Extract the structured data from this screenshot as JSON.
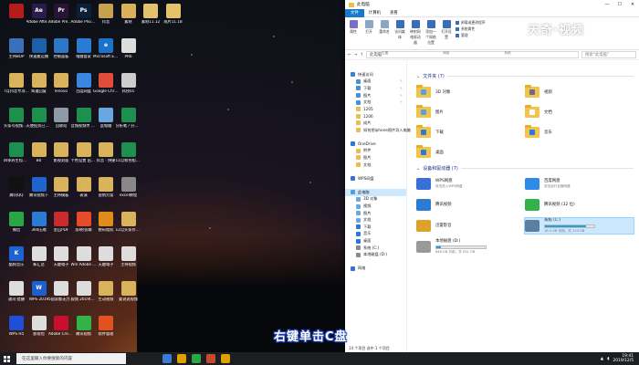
{
  "desktop_icons": [
    {
      "label": "",
      "color": "#b71c1c",
      "glyph": "",
      "col": 0,
      "row": 0
    },
    {
      "label": "Adobe After Effects CC 2018",
      "color": "#2a1b4d",
      "glyph": "Ae",
      "col": 1,
      "row": 0
    },
    {
      "label": "Adobe Premiere P...",
      "color": "#2a1436",
      "glyph": "Pr",
      "col": 2,
      "row": 0
    },
    {
      "label": "Adobe Photosh...",
      "color": "#0a1f3a",
      "glyph": "Ps",
      "col": 3,
      "row": 0
    },
    {
      "label": "抖音",
      "color": "#c8a150",
      "glyph": "",
      "col": 4,
      "row": 0
    },
    {
      "label": "素材",
      "color": "#d7b25a",
      "glyph": "",
      "col": 5,
      "row": 0
    },
    {
      "label": "素材11.12",
      "color": "#e4c26b",
      "glyph": "",
      "col": 6,
      "row": 0
    },
    {
      "label": "成片11.18",
      "color": "#e4c26b",
      "glyph": "",
      "col": 7,
      "row": 0
    },
    {
      "label": "主持BOP",
      "color": "#3c6fb7",
      "glyph": "",
      "col": 0,
      "row": 1
    },
    {
      "label": "快速搬运棚",
      "color": "#1d5fa8",
      "glyph": "",
      "col": 1,
      "row": 1
    },
    {
      "label": "控制面板",
      "color": "#2c78c6",
      "glyph": "",
      "col": 2,
      "row": 1
    },
    {
      "label": "电脑管家",
      "color": "#2b7bd3",
      "glyph": "",
      "col": 3,
      "row": 1
    },
    {
      "label": "Microsoft Edge",
      "color": "#1a73c9",
      "glyph": "e",
      "col": 4,
      "row": 1
    },
    {
      "label": "PR6",
      "color": "#ddd",
      "glyph": "",
      "col": 5,
      "row": 1
    },
    {
      "label": "7月抖音专项资料",
      "color": "#d9b35c",
      "glyph": "",
      "col": 0,
      "row": 2
    },
    {
      "label": "知道回复",
      "color": "#d9b35c",
      "glyph": "",
      "col": 1,
      "row": 2
    },
    {
      "label": "lenovo",
      "color": "#d9b35c",
      "glyph": "",
      "col": 2,
      "row": 2
    },
    {
      "label": "百度网盘",
      "color": "#3a86e0",
      "glyph": "",
      "col": 3,
      "row": 2
    },
    {
      "label": "Google Chrome",
      "color": "#e24c3b",
      "glyph": "",
      "col": 4,
      "row": 2
    },
    {
      "label": "科技01",
      "color": "#ccc",
      "glyph": "",
      "col": 5,
      "row": 2
    },
    {
      "label": "头条号视频分享给我做",
      "color": "#1d8f4e",
      "glyph": "",
      "col": 0,
      "row": 3
    },
    {
      "label": "天使投资已放电脑了",
      "color": "#1d8f4e",
      "glyph": "",
      "col": 1,
      "row": 3
    },
    {
      "label": "回收站",
      "color": "#8f9aa8",
      "glyph": "",
      "col": 2,
      "row": 3
    },
    {
      "label": "音频视频传 07.09(模)",
      "color": "#1d8f4e",
      "glyph": "",
      "col": 3,
      "row": 3
    },
    {
      "label": "此电脑",
      "color": "#6aa7e0",
      "glyph": "",
      "col": 4,
      "row": 3
    },
    {
      "label": "分析笔 / 分析 投资做电脑",
      "color": "#1d8f4e",
      "glyph": "",
      "col": 5,
      "row": 3
    },
    {
      "label": "四季养生短视频剪辑07.08",
      "color": "#1d8f4e",
      "glyph": "",
      "col": 0,
      "row": 4
    },
    {
      "label": "B0",
      "color": "#d9b35c",
      "glyph": "",
      "col": 1,
      "row": 4
    },
    {
      "label": "影视封面",
      "color": "#d9b35c",
      "glyph": "",
      "col": 2,
      "row": 4
    },
    {
      "label": "个性设置 出生语 word模板",
      "color": "#d9b35c",
      "glyph": "",
      "col": 3,
      "row": 4
    },
    {
      "label": "抖音 · 快捷",
      "color": "#d9b35c",
      "glyph": "",
      "col": 4,
      "row": 4
    },
    {
      "label": "11月和合相关的模板",
      "color": "#1d8f4e",
      "glyph": "",
      "col": 5,
      "row": 4
    },
    {
      "label": "腾讯QQ",
      "color": "#111",
      "glyph": "",
      "col": 0,
      "row": 5
    },
    {
      "label": "腾讯视频下",
      "color": "#1f63cf",
      "glyph": "",
      "col": 1,
      "row": 5
    },
    {
      "label": "主持模板",
      "color": "#d9b35c",
      "glyph": "",
      "col": 2,
      "row": 5
    },
    {
      "label": "表演",
      "color": "#d9b35c",
      "glyph": "",
      "col": 3,
      "row": 5
    },
    {
      "label": "营销方案",
      "color": "#d9b35c",
      "glyph": "",
      "col": 4,
      "row": 5
    },
    {
      "label": "excel教程",
      "color": "#888",
      "glyph": "",
      "col": 5,
      "row": 5
    },
    {
      "label": "微信",
      "color": "#2aa745",
      "glyph": "",
      "col": 0,
      "row": 6
    },
    {
      "label": "360压缩",
      "color": "#2a7bd6",
      "glyph": "",
      "col": 1,
      "row": 6
    },
    {
      "label": "金山PDF",
      "color": "#c82c2c",
      "glyph": "",
      "col": 2,
      "row": 6
    },
    {
      "label": "剪映/剪辑",
      "color": "#e64c2b",
      "glyph": "",
      "col": 3,
      "row": 6
    },
    {
      "label": "数码相机",
      "color": "#e08c1a",
      "glyph": "",
      "col": 4,
      "row": 6
    },
    {
      "label": "12月头条作业更新",
      "color": "#d9b35c",
      "glyph": "",
      "col": 5,
      "row": 6
    },
    {
      "label": "酷狗音乐",
      "color": "#1e63cf",
      "glyph": "K",
      "col": 0,
      "row": 7
    },
    {
      "label": "新汇总",
      "color": "#ddd",
      "glyph": "",
      "col": 1,
      "row": 7
    },
    {
      "label": "天融电子",
      "color": "#ddd",
      "glyph": "",
      "col": 2,
      "row": 7
    },
    {
      "label": "Win Adobe Win 2018 注册...",
      "color": "#ddd",
      "glyph": "",
      "col": 3,
      "row": 7
    },
    {
      "label": "天融电子",
      "color": "#ddd",
      "glyph": "",
      "col": 4,
      "row": 7
    },
    {
      "label": "主持视频",
      "color": "#ddd",
      "glyph": "",
      "col": 5,
      "row": 7
    },
    {
      "label": "通讯·提醒",
      "color": "#ddd",
      "glyph": "",
      "col": 0,
      "row": 8
    },
    {
      "label": "WPS 2019",
      "color": "#1e5fcf",
      "glyph": "W",
      "col": 1,
      "row": 8
    },
    {
      "label": "5国家都无力的 四字序字",
      "color": "#ddd",
      "glyph": "",
      "col": 2,
      "row": 8
    },
    {
      "label": "视频 2019(8)...",
      "color": "#ddd",
      "glyph": "",
      "col": 3,
      "row": 8
    },
    {
      "label": "生动视频",
      "color": "#d9b35c",
      "glyph": "",
      "col": 4,
      "row": 8
    },
    {
      "label": "要说说视频",
      "color": "#d9b35c",
      "glyph": "",
      "col": 5,
      "row": 8
    },
    {
      "label": "WPS H5",
      "color": "#1e4fd6",
      "glyph": "",
      "col": 0,
      "row": 9
    },
    {
      "label": "影视包",
      "color": "#ddd",
      "glyph": "",
      "col": 1,
      "row": 9
    },
    {
      "label": "Adobe Creati...",
      "color": "#c8102e",
      "glyph": "",
      "col": 2,
      "row": 9
    },
    {
      "label": "腾讯视频",
      "color": "#33b24a",
      "glyph": "",
      "col": 3,
      "row": 9
    },
    {
      "label": "软件管理",
      "color": "#e0521f",
      "glyph": "",
      "col": 4,
      "row": 9
    }
  ],
  "taskbar": {
    "search_placeholder": "在这里输入你要搜索的内容",
    "apps": [
      "#3a7bd5",
      "#e0a100",
      "#2aa745",
      "#c94a2b",
      "#e0a100"
    ],
    "time": "19:41",
    "date": "2019/12/5"
  },
  "explorer": {
    "title": "此电脑",
    "window_controls": [
      "—",
      "☐",
      "✕"
    ],
    "ribbon_tabs": [
      "文件",
      "计算机",
      "查看"
    ],
    "ribbon_buttons": [
      {
        "label": "属性",
        "color": "#7c6fc7"
      },
      {
        "label": "打开",
        "color": "#8aa7c7"
      },
      {
        "label": "重命名",
        "color": "#8aa7c7"
      },
      {
        "label": "访问媒体",
        "color": "#3a6db5"
      },
      {
        "label": "映射网络驱动器",
        "color": "#3a6db5"
      },
      {
        "label": "添加一个网络位置",
        "color": "#3a6db5"
      },
      {
        "label": "打开设置",
        "color": "#3a6db5"
      }
    ],
    "ribbon_list": [
      {
        "label": "卸载或更改程序",
        "color": "#3a6db5"
      },
      {
        "label": "系统属性",
        "color": "#3a6db5"
      },
      {
        "label": "管理",
        "color": "#3a6db5"
      }
    ],
    "ribbon_groups": [
      "位置",
      "网络",
      "系统"
    ],
    "address": "此电脑",
    "search_placeholder": "搜索\"此电脑\"",
    "nav": [
      {
        "label": "快速访问",
        "color": "#3b82d6",
        "pin": false,
        "indent": 0
      },
      {
        "label": "桌面",
        "color": "#4b8fd8",
        "pin": true,
        "indent": 1
      },
      {
        "label": "下载",
        "color": "#4b8fd8",
        "pin": true,
        "indent": 1
      },
      {
        "label": "图片",
        "color": "#4b8fd8",
        "pin": true,
        "indent": 1
      },
      {
        "label": "文档",
        "color": "#4b8fd8",
        "pin": true,
        "indent": 1
      },
      {
        "label": "1205",
        "color": "#e9bd52",
        "pin": false,
        "indent": 1
      },
      {
        "label": "1206",
        "color": "#e9bd52",
        "pin": false,
        "indent": 1
      },
      {
        "label": "成片",
        "color": "#e9bd52",
        "pin": false,
        "indent": 1
      },
      {
        "label": "如何把iphone照片导入电脑",
        "color": "#e9bd52",
        "pin": false,
        "indent": 1
      },
      {
        "label": "",
        "color": "transparent",
        "pin": false,
        "indent": 0
      },
      {
        "label": "OneDrive",
        "color": "#2a78d4",
        "pin": false,
        "indent": 0
      },
      {
        "label": "附件",
        "color": "#e9bd52",
        "pin": false,
        "indent": 1
      },
      {
        "label": "图片",
        "color": "#e9bd52",
        "pin": false,
        "indent": 1
      },
      {
        "label": "文档",
        "color": "#e9bd52",
        "pin": false,
        "indent": 1
      },
      {
        "label": "",
        "color": "transparent",
        "pin": false,
        "indent": 0
      },
      {
        "label": "WPS网盘",
        "color": "#3a6fd6",
        "pin": false,
        "indent": 0
      },
      {
        "label": "",
        "color": "transparent",
        "pin": false,
        "indent": 0
      },
      {
        "label": "此电脑",
        "color": "#5b9ad8",
        "pin": false,
        "indent": 0,
        "selected": true
      },
      {
        "label": "3D 对象",
        "color": "#6aa9e0",
        "pin": false,
        "indent": 1
      },
      {
        "label": "视频",
        "color": "#6aa9e0",
        "pin": false,
        "indent": 1
      },
      {
        "label": "图片",
        "color": "#6aa9e0",
        "pin": false,
        "indent": 1
      },
      {
        "label": "文档",
        "color": "#6aa9e0",
        "pin": false,
        "indent": 1
      },
      {
        "label": "下载",
        "color": "#2b79d6",
        "pin": false,
        "indent": 1
      },
      {
        "label": "音乐",
        "color": "#2b79d6",
        "pin": false,
        "indent": 1
      },
      {
        "label": "桌面",
        "color": "#2b79d6",
        "pin": false,
        "indent": 1
      },
      {
        "label": "系统 (C:)",
        "color": "#8a8a8a",
        "pin": false,
        "indent": 1
      },
      {
        "label": "本地磁盘 (D:)",
        "color": "#8a8a8a",
        "pin": false,
        "indent": 1
      },
      {
        "label": "",
        "color": "transparent",
        "pin": false,
        "indent": 0
      },
      {
        "label": "网络",
        "color": "#3a6fd6",
        "pin": false,
        "indent": 0
      }
    ],
    "folders_header": "文件夹 (7)",
    "folders": [
      {
        "label": "3D 对象",
        "mark": "#5aa0e0"
      },
      {
        "label": "视频",
        "mark": "#6b6b8a"
      },
      {
        "label": "图片",
        "mark": "#5aa0e0"
      },
      {
        "label": "文档",
        "mark": "#ffffff"
      },
      {
        "label": "下载",
        "mark": "#2b79d6"
      },
      {
        "label": "音乐",
        "mark": "#2b79d6"
      },
      {
        "label": "桌面",
        "mark": "#2b79d6"
      }
    ],
    "devices_header": "设备和驱动器 (7)",
    "devices": [
      {
        "label": "WPS网盘",
        "sub": "双击进入WPS网盘",
        "color": "#3a6fd6",
        "bar": null,
        "selected": false
      },
      {
        "label": "百度网盘",
        "sub": "双击运行百度网盘",
        "color": "#2f8bea",
        "bar": null,
        "selected": false
      },
      {
        "label": "腾讯视频",
        "sub": "",
        "color": "#2b7bd3",
        "bar": null,
        "selected": false
      },
      {
        "label": "腾讯视频 (32 位)",
        "sub": "",
        "color": "#33b24a",
        "bar": null,
        "selected": false
      },
      {
        "label": "迅雷影音",
        "sub": "",
        "color": "#e0a12a",
        "bar": null,
        "selected": false
      },
      {
        "label": "系统 (C:)",
        "sub": "18.5 GB 可用，共 114 GB",
        "color": "#5b7fa0",
        "bar": 0.84,
        "selected": true
      },
      {
        "label": "本地磁盘 (D:)",
        "sub": "846 GB 可用，共 931 GB",
        "color": "#9a9a9a",
        "bar": 0.09,
        "selected": false
      }
    ],
    "status": "14 个项目    选中 1 个项目"
  },
  "watermark": "天奇·视频",
  "caption": "右键单击C盘"
}
